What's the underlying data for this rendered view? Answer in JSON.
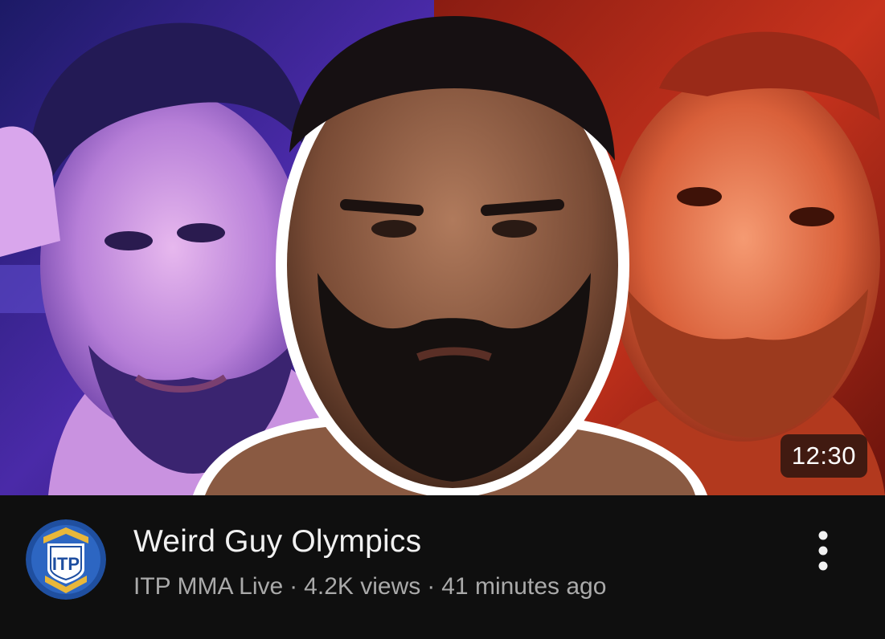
{
  "video": {
    "thumbnail_icon": "three-fighters-portrait-thumbnail",
    "duration": "12:30",
    "title": "Weird Guy Olympics",
    "channel": "ITP MMA Live",
    "separator": "·",
    "views": "4.2K views",
    "published": "41 minutes ago",
    "more_icon": "vertical-ellipsis-icon"
  },
  "channel_avatar": {
    "icon": "itp-shield-logo",
    "logo_text": "ITP",
    "colors": {
      "ring": "#1f4fa0",
      "gold": "#e9b73a",
      "shield": "#ffffff"
    }
  },
  "theme": {
    "background": "#0f0f0f",
    "title_color": "#f1f1f1",
    "meta_color": "#aaaaaa"
  }
}
